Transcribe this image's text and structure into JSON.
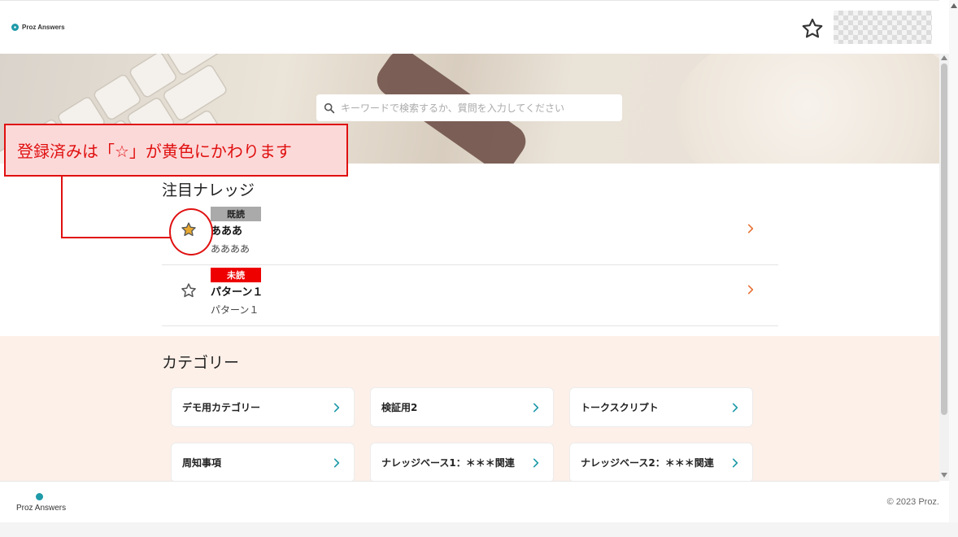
{
  "header": {
    "logo_text": "Proz Answers",
    "avatar_alt": ""
  },
  "hero": {
    "search_placeholder": "キーワードで検索するか、質問を入力してください"
  },
  "callout": {
    "text": "登録済みは「☆」が黄色にかわります"
  },
  "knowledge": {
    "title": "注目ナレッジ",
    "items": [
      {
        "badge": "既読",
        "badge_color": "#aaaaaa",
        "title": "あああ",
        "subtitle": "ああああ",
        "starred": true
      },
      {
        "badge": "未読",
        "badge_color": "#ee0000",
        "title": "パターン１",
        "subtitle": "パターン１",
        "starred": false
      }
    ]
  },
  "categories": {
    "title": "カテゴリー",
    "items": [
      {
        "label": "デモ用カテゴリー"
      },
      {
        "label": "検証用2"
      },
      {
        "label": "トークスクリプト"
      },
      {
        "label": "周知事項"
      },
      {
        "label": "ナレッジベース1：＊＊＊関連"
      },
      {
        "label": "ナレッジベース2：＊＊＊関連"
      }
    ]
  },
  "footer": {
    "logo_text": "Proz Answers",
    "copyright": "© 2023 Proz."
  },
  "colors": {
    "accent": "#1e9aa8",
    "chevron_orange": "#e8733a",
    "star_gold": "#e8a830",
    "callout_red": "#e01010",
    "category_bg": "#fdf0e8"
  },
  "icons": {
    "header_star": "star-outline-icon",
    "search": "search-icon",
    "item_chevron": "chevron-right-icon"
  }
}
